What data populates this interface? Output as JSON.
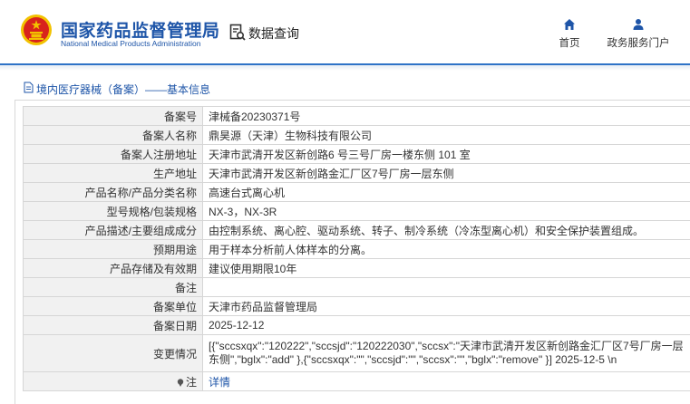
{
  "header": {
    "title": "国家药品监督管理局",
    "subtitle": "National Medical Products Administration",
    "query_label": "数据查询",
    "nav": [
      {
        "label": "首页",
        "icon": "home-icon"
      },
      {
        "label": "政务服务门户",
        "icon": "user-icon"
      }
    ]
  },
  "breadcrumb": {
    "text": "境内医疗器械（备案）——基本信息"
  },
  "record": {
    "rows": [
      {
        "label": "备案号",
        "value": "津械备20230371号"
      },
      {
        "label": "备案人名称",
        "value": "鼎昊源（天津）生物科技有限公司"
      },
      {
        "label": "备案人注册地址",
        "value": "天津市武清开发区新创路6 号三号厂房一楼东侧 101 室"
      },
      {
        "label": "生产地址",
        "value": "天津市武清开发区新创路金汇厂区7号厂房一层东侧"
      },
      {
        "label": "产品名称/产品分类名称",
        "value": "高速台式离心机"
      },
      {
        "label": "型号规格/包装规格",
        "value": "NX-3，NX-3R"
      },
      {
        "label": "产品描述/主要组成成分",
        "value": "由控制系统、离心腔、驱动系统、转子、制冷系统（冷冻型离心机）和安全保护装置组成。"
      },
      {
        "label": "预期用途",
        "value": "用于样本分析前人体样本的分离。"
      },
      {
        "label": "产品存储及有效期",
        "value": "建议使用期限10年"
      },
      {
        "label": "备注",
        "value": ""
      },
      {
        "label": "备案单位",
        "value": "天津市药品监督管理局"
      },
      {
        "label": "备案日期",
        "value": "2025-12-12"
      },
      {
        "label": "变更情况",
        "value": "[{\"sccsxqx\":\"120222\",\"sccsjd\":\"120222030\",\"sccsx\":\"天津市武清开发区新创路金汇厂区7号厂房一层东侧\",\"bglx\":\"add\" },{\"sccsxqx\":\"\",\"sccsjd\":\"\",\"sccsx\":\"\",\"bglx\":\"remove\" }] 2025-12-5 \\n"
      }
    ],
    "note": {
      "label": "注",
      "link_text": "详情"
    }
  },
  "colors": {
    "brand_blue": "#1e55a8",
    "accent_line": "#2f73c7",
    "emblem_red": "#d8231c",
    "emblem_gold": "#f2c200"
  }
}
